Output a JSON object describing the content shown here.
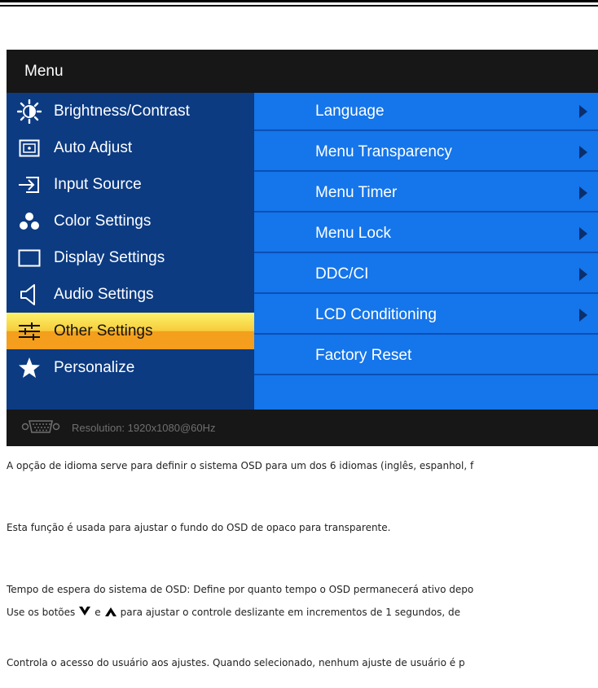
{
  "osd": {
    "title": "Menu",
    "left_menu": [
      {
        "label": "Brightness/Contrast",
        "icon": "brightness-icon"
      },
      {
        "label": "Auto Adjust",
        "icon": "auto-adjust-icon"
      },
      {
        "label": "Input Source",
        "icon": "input-source-icon"
      },
      {
        "label": "Color Settings",
        "icon": "color-settings-icon"
      },
      {
        "label": "Display Settings",
        "icon": "display-settings-icon"
      },
      {
        "label": "Audio Settings",
        "icon": "speaker-icon"
      },
      {
        "label": "Other Settings",
        "icon": "sliders-icon",
        "selected": true
      },
      {
        "label": "Personalize",
        "icon": "star-icon"
      }
    ],
    "right_menu": [
      {
        "label": "Language",
        "has_submenu": true
      },
      {
        "label": "Menu Transparency",
        "has_submenu": true
      },
      {
        "label": "Menu Timer",
        "has_submenu": true
      },
      {
        "label": "Menu Lock",
        "has_submenu": true
      },
      {
        "label": "DDC/CI",
        "has_submenu": true
      },
      {
        "label": "LCD Conditioning",
        "has_submenu": true
      },
      {
        "label": "Factory Reset",
        "has_submenu": false
      }
    ],
    "status": {
      "connector_icon": "vga-connector-icon",
      "text": "Resolution:  1920x1080@60Hz"
    },
    "colors": {
      "left_panel": "#0c3b82",
      "right_panel": "#1575ea",
      "highlight": "#f7b52a",
      "background": "#171717"
    }
  },
  "descriptions": {
    "language": "A opção de idioma serve para definir o sistema OSD para um dos 6 idiomas (inglês, espanhol, f",
    "transparency": "Esta função é usada para ajustar o fundo do OSD de opaco para transparente.",
    "timer_line1": "Tempo de espera do sistema de OSD: Define por quanto tempo o OSD permanecerá ativo depo",
    "timer_line2_pre": "Use os botões",
    "timer_line2_mid": "e",
    "timer_line2_post": "para ajustar o controle deslizante em incrementos de 1 segundos, de",
    "lock": "Controla o acesso do usuário aos ajustes. Quando selecionado, nenhum ajuste de usuário é p"
  }
}
